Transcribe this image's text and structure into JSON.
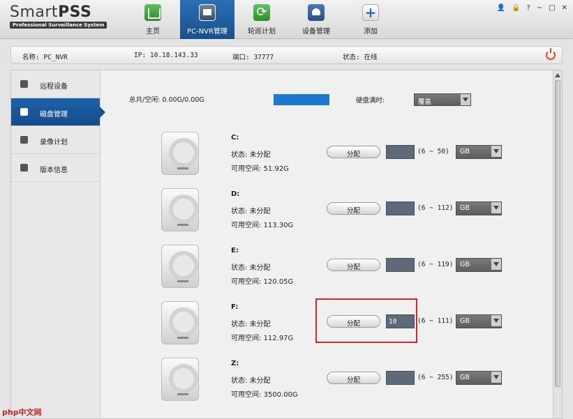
{
  "app": {
    "logo_title": "Smart",
    "logo_title_bold": "PSS",
    "logo_subtitle": "Professional Surveillance System"
  },
  "nav": [
    {
      "label": "主页",
      "icon": "home-icon"
    },
    {
      "label": "PC-NVR管理",
      "icon": "nvr-icon",
      "active": true
    },
    {
      "label": "轮巡计划",
      "icon": "tour-icon"
    },
    {
      "label": "设备管理",
      "icon": "device-icon"
    },
    {
      "label": "添加",
      "icon": "add-icon"
    }
  ],
  "window_controls": {
    "user": "👤",
    "lock": "🔒",
    "help": "?",
    "minimize": "−",
    "maximize": "□",
    "close": "✕"
  },
  "info": {
    "name": "名称:  PC_NVR",
    "ip": "IP: 10.18.143.33",
    "port": "端口:  37777",
    "status": "状态:  在线"
  },
  "sidebar": [
    {
      "label": "远程设备",
      "icon": "gear-icon"
    },
    {
      "label": "磁盘管理",
      "icon": "disk-icon",
      "active": true
    },
    {
      "label": "录像计划",
      "icon": "record-icon"
    },
    {
      "label": "版本信息",
      "icon": "info-list-icon"
    }
  ],
  "summary": {
    "total_free": "总共/空闲: 0.00G/0.00G",
    "disk_full_label": "硬盘满时:",
    "disk_full_value": "覆盖",
    "capacity_color": "#1c78cf"
  },
  "disks": [
    {
      "name": "C:",
      "status": "状态: 未分配",
      "free": "可用空间: 51.92G",
      "button": "分配",
      "input": "",
      "range": "(6 ~ 50)",
      "unit": "GB"
    },
    {
      "name": "D:",
      "status": "状态: 未分配",
      "free": "可用空间: 113.30G",
      "button": "分配",
      "input": "",
      "range": "(6 ~ 112)",
      "unit": "GB"
    },
    {
      "name": "E:",
      "status": "状态: 未分配",
      "free": "可用空间: 120.05G",
      "button": "分配",
      "input": "",
      "range": "(6 ~ 119)",
      "unit": "GB"
    },
    {
      "name": "F:",
      "status": "状态: 未分配",
      "free": "可用空间: 112.97G",
      "button": "分配",
      "input": "10",
      "range": "(6 ~ 111)",
      "unit": "GB"
    },
    {
      "name": "Z:",
      "status": "状态: 未分配",
      "free": "可用空间: 3500.00G",
      "button": "分配",
      "input": "",
      "range": "(6 ~ 255)",
      "unit": "GB"
    }
  ],
  "watermark": "php中文网",
  "colors": {
    "accent": "#1a5fa8",
    "highlight": "#d22a2a"
  }
}
